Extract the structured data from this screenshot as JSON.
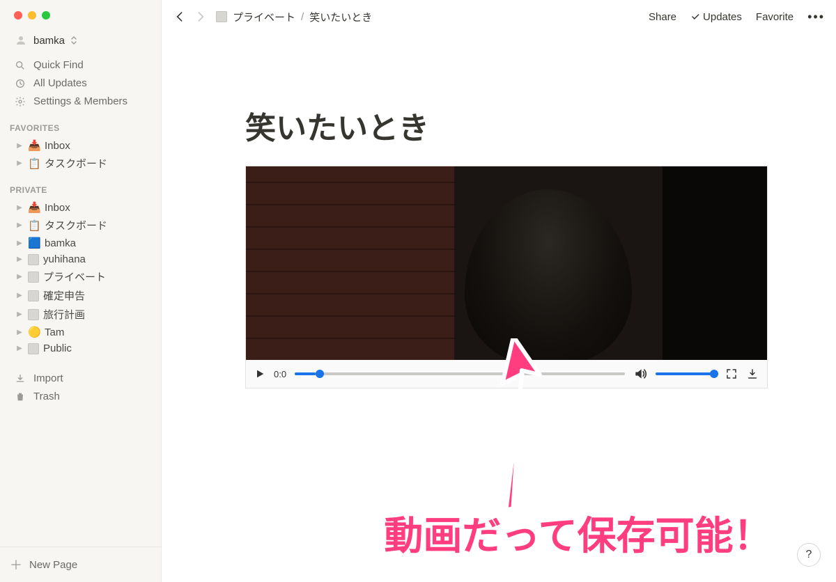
{
  "workspace": {
    "name": "bamka",
    "icon": "👤"
  },
  "sidebar": {
    "quickFind": "Quick Find",
    "allUpdates": "All Updates",
    "settings": "Settings & Members",
    "favoritesLabel": "FAVORITES",
    "favorites": [
      {
        "icon": "📥",
        "label": "Inbox"
      },
      {
        "icon": "📋",
        "label": "タスクボード"
      }
    ],
    "privateLabel": "PRIVATE",
    "private": [
      {
        "icon": "📥",
        "label": "Inbox"
      },
      {
        "icon": "📋",
        "label": "タスクボード"
      },
      {
        "icon": "🟦",
        "label": "bamka"
      },
      {
        "icon": "page",
        "label": "yuhihana"
      },
      {
        "icon": "page",
        "label": "プライベート"
      },
      {
        "icon": "page",
        "label": "確定申告"
      },
      {
        "icon": "page",
        "label": "旅行計画"
      },
      {
        "icon": "🟡",
        "label": "Tam"
      },
      {
        "icon": "page",
        "label": "Public"
      }
    ],
    "import": "Import",
    "trash": "Trash",
    "newPage": "New Page"
  },
  "breadcrumb": {
    "parent": "プライベート",
    "current": "笑いたいとき"
  },
  "topbar": {
    "share": "Share",
    "updates": "Updates",
    "favorite": "Favorite"
  },
  "page": {
    "title": "笑いたいとき"
  },
  "video": {
    "currentTime": "0:0"
  },
  "annotation": {
    "text": "動画だって保存可能！"
  },
  "help": "?"
}
